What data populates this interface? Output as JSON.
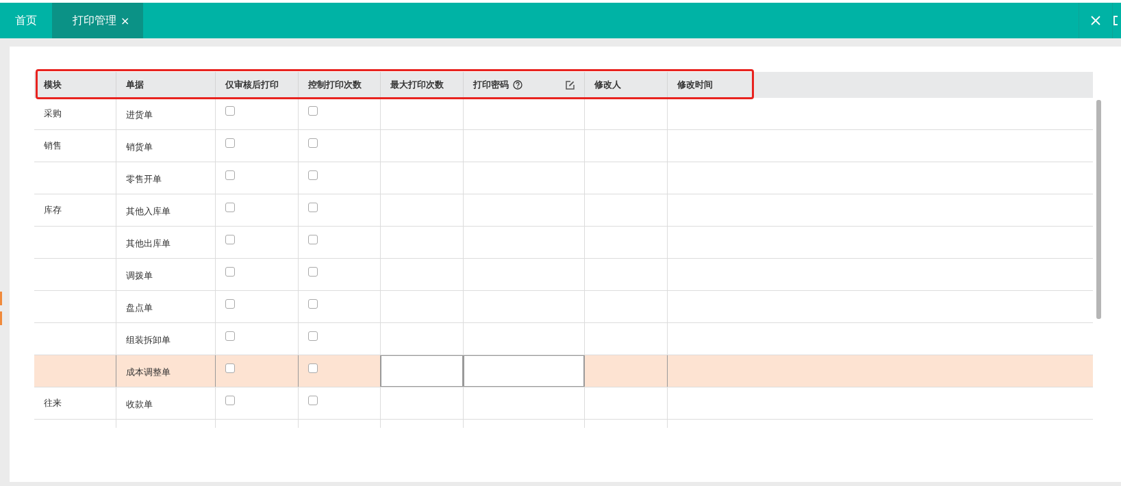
{
  "tabs": [
    {
      "label": "首页",
      "selected": false,
      "closable": false
    },
    {
      "label": "打印管理",
      "selected": true,
      "closable": true,
      "close_glyph": "×"
    }
  ],
  "table": {
    "header_highlight": true,
    "columns": [
      {
        "label": "模块",
        "kind": "module"
      },
      {
        "label": "单据",
        "kind": "document"
      },
      {
        "label": "仅审核后打印",
        "kind": "check"
      },
      {
        "label": "控制打印次数",
        "kind": "check"
      },
      {
        "label": "最大打印次数",
        "kind": "input"
      },
      {
        "label": "打印密码",
        "kind": "input",
        "help": true,
        "edit": true
      },
      {
        "label": "修改人",
        "kind": "text"
      },
      {
        "label": "修改时间",
        "kind": "text"
      }
    ],
    "rows": [
      {
        "module": "采购",
        "document": "进货单",
        "audit_print_only": false,
        "limit_prints": false,
        "selected": false
      },
      {
        "module": "销售",
        "document": "销货单",
        "audit_print_only": false,
        "limit_prints": false,
        "selected": false
      },
      {
        "document": "零售开单",
        "audit_print_only": false,
        "limit_prints": false,
        "selected": false
      },
      {
        "module": "库存",
        "document": "其他入库单",
        "audit_print_only": false,
        "limit_prints": false,
        "selected": false
      },
      {
        "document": "其他出库单",
        "audit_print_only": false,
        "limit_prints": false,
        "selected": false
      },
      {
        "document": "调拨单",
        "audit_print_only": false,
        "limit_prints": false,
        "selected": false
      },
      {
        "document": "盘点单",
        "audit_print_only": false,
        "limit_prints": false,
        "selected": false
      },
      {
        "document": "组装拆卸单",
        "audit_print_only": false,
        "limit_prints": false,
        "selected": false
      },
      {
        "document": "成本调整单",
        "audit_print_only": false,
        "limit_prints": false,
        "selected": true
      },
      {
        "module": "往来",
        "document": "收款单",
        "audit_print_only": false,
        "limit_prints": false,
        "selected": false
      }
    ]
  }
}
